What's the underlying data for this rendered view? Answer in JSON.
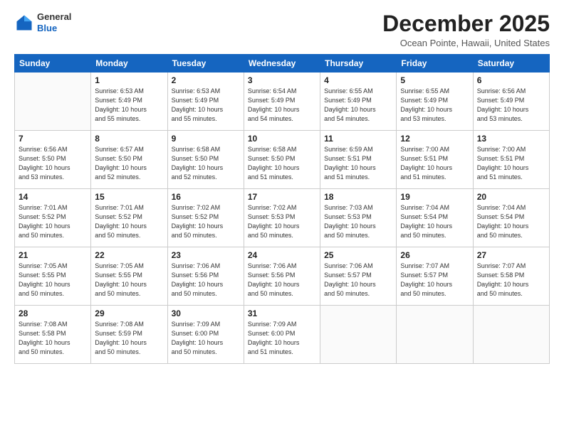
{
  "header": {
    "logo": {
      "general": "General",
      "blue": "Blue"
    },
    "title": "December 2025",
    "location": "Ocean Pointe, Hawaii, United States"
  },
  "calendar": {
    "days_of_week": [
      "Sunday",
      "Monday",
      "Tuesday",
      "Wednesday",
      "Thursday",
      "Friday",
      "Saturday"
    ],
    "weeks": [
      [
        {
          "day": "",
          "info": ""
        },
        {
          "day": "1",
          "info": "Sunrise: 6:53 AM\nSunset: 5:49 PM\nDaylight: 10 hours\nand 55 minutes."
        },
        {
          "day": "2",
          "info": "Sunrise: 6:53 AM\nSunset: 5:49 PM\nDaylight: 10 hours\nand 55 minutes."
        },
        {
          "day": "3",
          "info": "Sunrise: 6:54 AM\nSunset: 5:49 PM\nDaylight: 10 hours\nand 54 minutes."
        },
        {
          "day": "4",
          "info": "Sunrise: 6:55 AM\nSunset: 5:49 PM\nDaylight: 10 hours\nand 54 minutes."
        },
        {
          "day": "5",
          "info": "Sunrise: 6:55 AM\nSunset: 5:49 PM\nDaylight: 10 hours\nand 53 minutes."
        },
        {
          "day": "6",
          "info": "Sunrise: 6:56 AM\nSunset: 5:49 PM\nDaylight: 10 hours\nand 53 minutes."
        }
      ],
      [
        {
          "day": "7",
          "info": "Sunrise: 6:56 AM\nSunset: 5:50 PM\nDaylight: 10 hours\nand 53 minutes."
        },
        {
          "day": "8",
          "info": "Sunrise: 6:57 AM\nSunset: 5:50 PM\nDaylight: 10 hours\nand 52 minutes."
        },
        {
          "day": "9",
          "info": "Sunrise: 6:58 AM\nSunset: 5:50 PM\nDaylight: 10 hours\nand 52 minutes."
        },
        {
          "day": "10",
          "info": "Sunrise: 6:58 AM\nSunset: 5:50 PM\nDaylight: 10 hours\nand 51 minutes."
        },
        {
          "day": "11",
          "info": "Sunrise: 6:59 AM\nSunset: 5:51 PM\nDaylight: 10 hours\nand 51 minutes."
        },
        {
          "day": "12",
          "info": "Sunrise: 7:00 AM\nSunset: 5:51 PM\nDaylight: 10 hours\nand 51 minutes."
        },
        {
          "day": "13",
          "info": "Sunrise: 7:00 AM\nSunset: 5:51 PM\nDaylight: 10 hours\nand 51 minutes."
        }
      ],
      [
        {
          "day": "14",
          "info": "Sunrise: 7:01 AM\nSunset: 5:52 PM\nDaylight: 10 hours\nand 50 minutes."
        },
        {
          "day": "15",
          "info": "Sunrise: 7:01 AM\nSunset: 5:52 PM\nDaylight: 10 hours\nand 50 minutes."
        },
        {
          "day": "16",
          "info": "Sunrise: 7:02 AM\nSunset: 5:52 PM\nDaylight: 10 hours\nand 50 minutes."
        },
        {
          "day": "17",
          "info": "Sunrise: 7:02 AM\nSunset: 5:53 PM\nDaylight: 10 hours\nand 50 minutes."
        },
        {
          "day": "18",
          "info": "Sunrise: 7:03 AM\nSunset: 5:53 PM\nDaylight: 10 hours\nand 50 minutes."
        },
        {
          "day": "19",
          "info": "Sunrise: 7:04 AM\nSunset: 5:54 PM\nDaylight: 10 hours\nand 50 minutes."
        },
        {
          "day": "20",
          "info": "Sunrise: 7:04 AM\nSunset: 5:54 PM\nDaylight: 10 hours\nand 50 minutes."
        }
      ],
      [
        {
          "day": "21",
          "info": "Sunrise: 7:05 AM\nSunset: 5:55 PM\nDaylight: 10 hours\nand 50 minutes."
        },
        {
          "day": "22",
          "info": "Sunrise: 7:05 AM\nSunset: 5:55 PM\nDaylight: 10 hours\nand 50 minutes."
        },
        {
          "day": "23",
          "info": "Sunrise: 7:06 AM\nSunset: 5:56 PM\nDaylight: 10 hours\nand 50 minutes."
        },
        {
          "day": "24",
          "info": "Sunrise: 7:06 AM\nSunset: 5:56 PM\nDaylight: 10 hours\nand 50 minutes."
        },
        {
          "day": "25",
          "info": "Sunrise: 7:06 AM\nSunset: 5:57 PM\nDaylight: 10 hours\nand 50 minutes."
        },
        {
          "day": "26",
          "info": "Sunrise: 7:07 AM\nSunset: 5:57 PM\nDaylight: 10 hours\nand 50 minutes."
        },
        {
          "day": "27",
          "info": "Sunrise: 7:07 AM\nSunset: 5:58 PM\nDaylight: 10 hours\nand 50 minutes."
        }
      ],
      [
        {
          "day": "28",
          "info": "Sunrise: 7:08 AM\nSunset: 5:58 PM\nDaylight: 10 hours\nand 50 minutes."
        },
        {
          "day": "29",
          "info": "Sunrise: 7:08 AM\nSunset: 5:59 PM\nDaylight: 10 hours\nand 50 minutes."
        },
        {
          "day": "30",
          "info": "Sunrise: 7:09 AM\nSunset: 6:00 PM\nDaylight: 10 hours\nand 50 minutes."
        },
        {
          "day": "31",
          "info": "Sunrise: 7:09 AM\nSunset: 6:00 PM\nDaylight: 10 hours\nand 51 minutes."
        },
        {
          "day": "",
          "info": ""
        },
        {
          "day": "",
          "info": ""
        },
        {
          "day": "",
          "info": ""
        }
      ]
    ]
  }
}
